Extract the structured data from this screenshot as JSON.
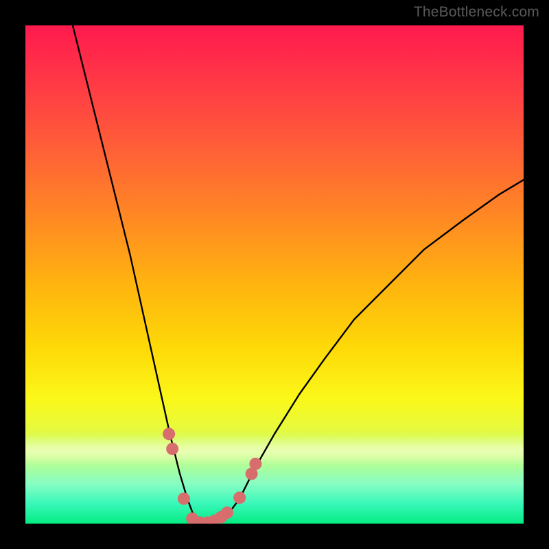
{
  "watermark": "TheBottleneck.com",
  "chart_data": {
    "type": "line",
    "title": "",
    "xlabel": "",
    "ylabel": "",
    "xlim": [
      0,
      100
    ],
    "ylim": [
      0,
      100
    ],
    "grid": false,
    "legend": null,
    "background_gradient": {
      "orientation": "vertical",
      "stops": [
        {
          "pos": 0.0,
          "color": "#ff1a4e"
        },
        {
          "pos": 0.12,
          "color": "#ff3a45"
        },
        {
          "pos": 0.25,
          "color": "#ff6037"
        },
        {
          "pos": 0.38,
          "color": "#ff8724"
        },
        {
          "pos": 0.52,
          "color": "#ffb40f"
        },
        {
          "pos": 0.65,
          "color": "#feda08"
        },
        {
          "pos": 0.75,
          "color": "#fbf81a"
        },
        {
          "pos": 0.81,
          "color": "#e6fa3d"
        },
        {
          "pos": 0.86,
          "color": "#c4fe7c"
        },
        {
          "pos": 0.92,
          "color": "#88fdc4"
        },
        {
          "pos": 0.96,
          "color": "#38f8b9"
        },
        {
          "pos": 1.0,
          "color": "#05eb83"
        }
      ]
    },
    "series": [
      {
        "name": "bottleneck-curve",
        "color": "#000000",
        "x": [
          9.5,
          12,
          15,
          17,
          19,
          21,
          23,
          25,
          27,
          29,
          31,
          32.5,
          34,
          36,
          38,
          40,
          43,
          46,
          50,
          55,
          60,
          66,
          73,
          80,
          88,
          95,
          100
        ],
        "y": [
          100,
          90,
          78,
          70,
          62,
          54,
          45,
          36,
          27,
          18,
          10,
          5,
          1,
          0,
          0,
          1,
          5,
          11,
          18,
          26,
          33,
          41,
          48,
          55,
          61,
          66,
          69
        ]
      }
    ],
    "markers": {
      "name": "highlight-dots",
      "color": "#d86d6d",
      "radius_px": 9,
      "points": [
        {
          "x": 28.8,
          "y": 18.0
        },
        {
          "x": 29.5,
          "y": 15.0
        },
        {
          "x": 31.8,
          "y": 5.0
        },
        {
          "x": 33.5,
          "y": 1.0
        },
        {
          "x": 35.0,
          "y": 0.2
        },
        {
          "x": 36.5,
          "y": 0.2
        },
        {
          "x": 38.0,
          "y": 0.6
        },
        {
          "x": 39.3,
          "y": 1.3
        },
        {
          "x": 40.5,
          "y": 2.2
        },
        {
          "x": 43.0,
          "y": 5.2
        },
        {
          "x": 45.4,
          "y": 10.0
        },
        {
          "x": 46.2,
          "y": 12.0
        }
      ]
    }
  }
}
